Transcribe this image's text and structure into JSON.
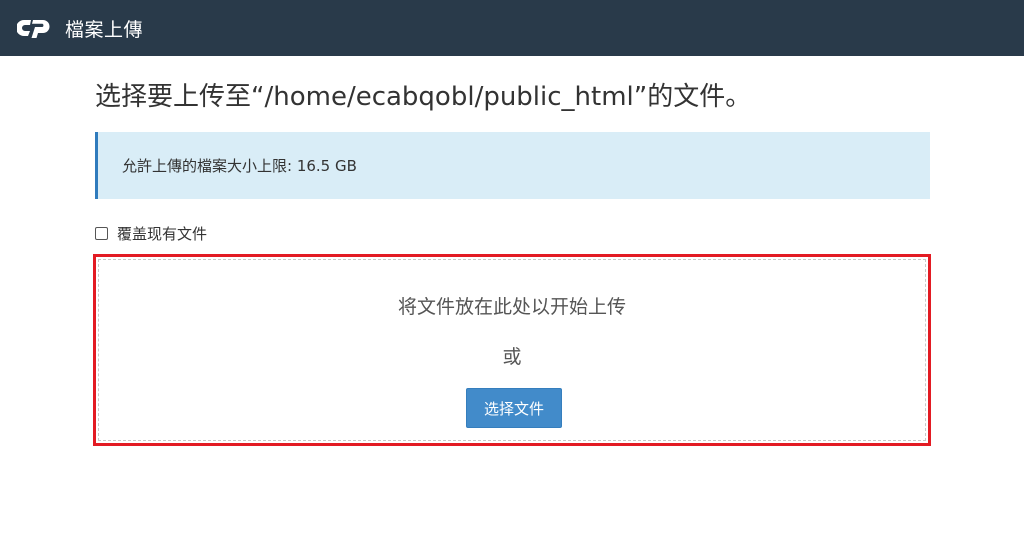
{
  "header": {
    "title": "檔案上傳",
    "logo_icon": "cpanel-logo-icon"
  },
  "main": {
    "title": "选择要上传至“/home/ecabqobl/public_html”的文件。",
    "info": "允許上傳的檔案大小上限: 16.5 GB",
    "overwrite_label": "覆盖现有文件",
    "overwrite_checked": false,
    "dropzone": {
      "drop_text": "将文件放在此处以开始上传",
      "or_text": "或",
      "button_label": "选择文件"
    }
  },
  "colors": {
    "header_bg": "#293a4a",
    "info_bg": "#d9edf7",
    "info_border": "#2f7bbd",
    "dropzone_border": "#e31b23",
    "button_bg": "#428bca"
  }
}
